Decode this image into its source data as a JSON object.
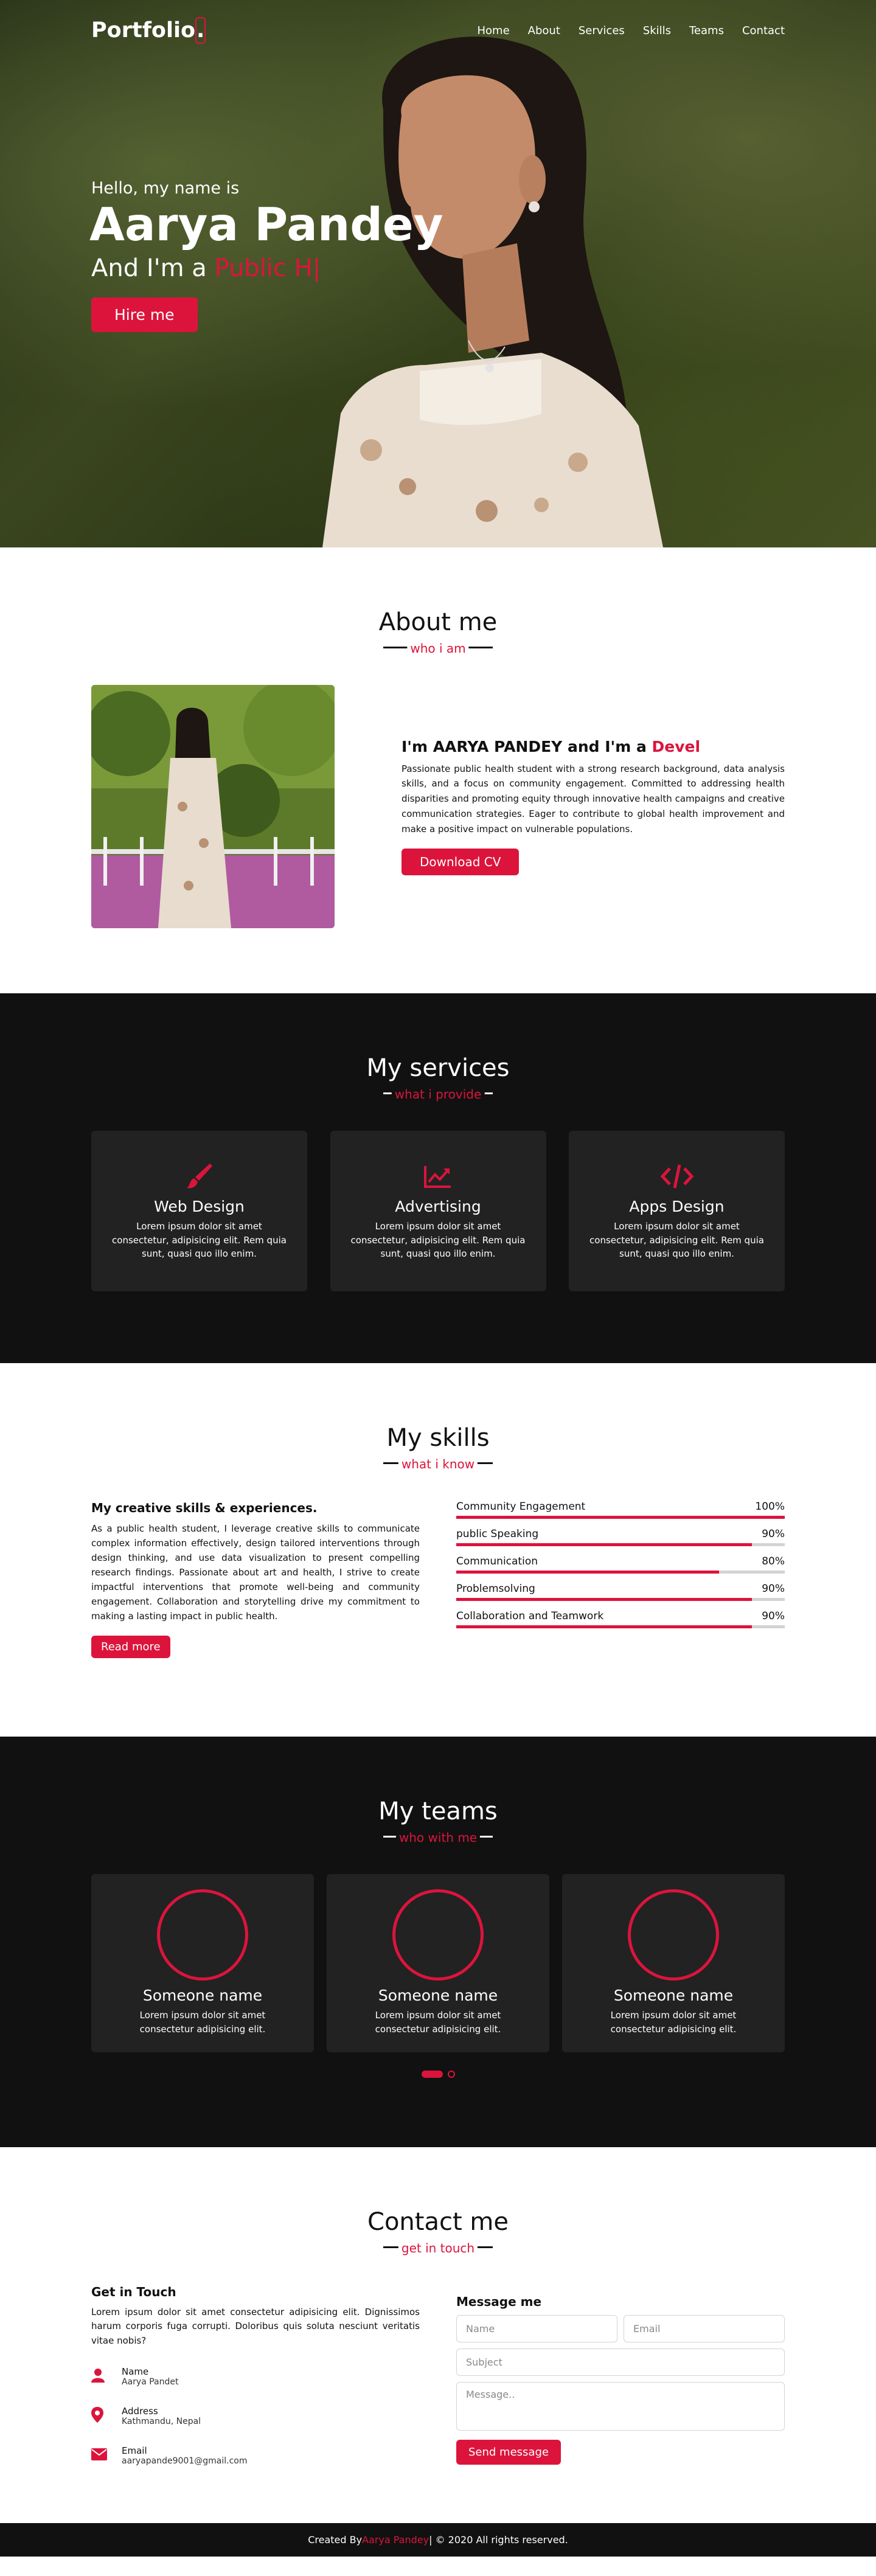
{
  "nav": {
    "logo": "Portfolio",
    "logo_dot": ".",
    "items": [
      "Home",
      "About",
      "Services",
      "Skills",
      "Teams",
      "Contact"
    ]
  },
  "home": {
    "text1": "Hello, my name is",
    "name": "Aarya Pandey",
    "text3_prefix": "And I'm a ",
    "typing": "Public H|",
    "hire_button": "Hire me"
  },
  "about": {
    "title": "About me",
    "subtitle": "who i am",
    "heading_prefix": "I'm AARYA PANDEY and I'm a ",
    "heading_typing": "Devel",
    "paragraph": "Passionate public health student with a strong research background, data analysis skills, and a focus on community engagement. Committed to addressing health disparities and promoting equity through innovative health campaigns and creative communication strategies. Eager to contribute to global health improvement and make a positive impact on vulnerable populations.",
    "button": "Download CV"
  },
  "services": {
    "title": "My services",
    "subtitle": "what i provide",
    "cards": [
      {
        "icon": "paint-brush-icon",
        "title": "Web Design",
        "desc": "Lorem ipsum dolor sit amet consectetur, adipisicing elit. Rem quia sunt, quasi quo illo enim."
      },
      {
        "icon": "chart-line-icon",
        "title": "Advertising",
        "desc": "Lorem ipsum dolor sit amet consectetur, adipisicing elit. Rem quia sunt, quasi quo illo enim."
      },
      {
        "icon": "code-icon",
        "title": "Apps Design",
        "desc": "Lorem ipsum dolor sit amet consectetur, adipisicing elit. Rem quia sunt, quasi quo illo enim."
      }
    ]
  },
  "skills": {
    "title": "My skills",
    "subtitle": "what i know",
    "left_heading": "My creative skills & experiences.",
    "left_paragraph": "As a public health student, I leverage creative skills to communicate complex information effectively, design tailored interventions through design thinking, and use data visualization to present compelling research findings. Passionate about art and health, I strive to create impactful interventions that promote well-being and community engagement. Collaboration and storytelling drive my commitment to making a lasting impact in public health.",
    "button": "Read more",
    "bars": [
      {
        "name": "Community Engagement",
        "percent": "100%",
        "value": 100
      },
      {
        "name": "public Speaking",
        "percent": "90%",
        "value": 90
      },
      {
        "name": "Communication",
        "percent": "80%",
        "value": 80
      },
      {
        "name": "Problemsolving",
        "percent": "90%",
        "value": 90
      },
      {
        "name": "Collaboration and Teamwork",
        "percent": "90%",
        "value": 90
      }
    ]
  },
  "teams": {
    "title": "My teams",
    "subtitle": "who with me",
    "cards": [
      {
        "name": "Someone name",
        "desc": "Lorem ipsum dolor sit amet consectetur adipisicing elit."
      },
      {
        "name": "Someone name",
        "desc": "Lorem ipsum dolor sit amet consectetur adipisicing elit."
      },
      {
        "name": "Someone name",
        "desc": "Lorem ipsum dolor sit amet consectetur adipisicing elit."
      }
    ]
  },
  "contact": {
    "title": "Contact me",
    "subtitle": "get in touch",
    "left_heading": "Get in Touch",
    "left_paragraph": "Lorem ipsum dolor sit amet consectetur adipisicing elit. Dignissimos harum corporis fuga corrupti. Doloribus quis soluta nesciunt veritatis vitae nobis?",
    "rows": [
      {
        "icon": "user-icon",
        "head": "Name",
        "sub": "Aarya Pandet"
      },
      {
        "icon": "map-marker-icon",
        "head": "Address",
        "sub": "Kathmandu, Nepal"
      },
      {
        "icon": "envelope-icon",
        "head": "Email",
        "sub": "aaryapande9001@gmail.com"
      }
    ],
    "right_heading": "Message me",
    "name_placeholder": "Name",
    "email_placeholder": "Email",
    "subject_placeholder": "Subject",
    "message_placeholder": "Message..",
    "send_button": "Send message"
  },
  "footer": {
    "prefix": "Created By ",
    "author": "Aarya Pandey",
    "suffix": " | © 2020 All rights reserved."
  },
  "colors": {
    "accent": "#dc143c",
    "dark_bg": "#111111",
    "card_bg": "#222222"
  }
}
